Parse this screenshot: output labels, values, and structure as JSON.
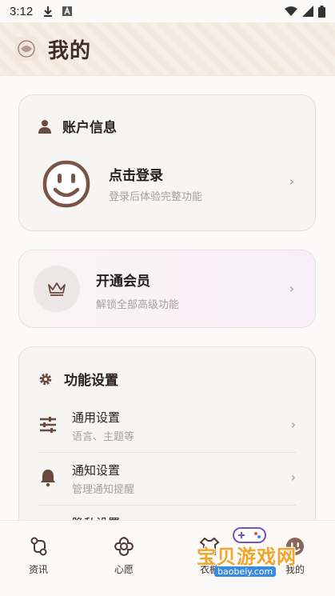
{
  "status_bar": {
    "time": "3:12",
    "icons": [
      "download-icon",
      "a-box-icon",
      "wifi-icon",
      "signal-icon",
      "battery-icon"
    ]
  },
  "header": {
    "title": "我的"
  },
  "account": {
    "section_title": "账户信息",
    "login_title": "点击登录",
    "login_subtitle": "登录后体验完整功能"
  },
  "vip": {
    "title": "开通会员",
    "subtitle": "解锁全部高级功能"
  },
  "settings": {
    "section_title": "功能设置",
    "items": [
      {
        "title": "通用设置",
        "subtitle": "语言、主题等",
        "icon": "sliders-icon"
      },
      {
        "title": "通知设置",
        "subtitle": "管理通知提醒",
        "icon": "bell-icon"
      },
      {
        "title": "隐私设置",
        "subtitle": "",
        "icon": "lock-icon"
      }
    ]
  },
  "bottom_nav": {
    "items": [
      {
        "label": "资讯",
        "icon": "news-icon"
      },
      {
        "label": "心愿",
        "icon": "flower-icon"
      },
      {
        "label": "衣橱",
        "icon": "wardrobe-icon"
      },
      {
        "label": "我的",
        "icon": "profile-icon"
      }
    ]
  },
  "watermark": {
    "text": "宝贝游戏网",
    "url": "baobeiy.com"
  },
  "colors": {
    "accent": "#6b4a3e",
    "background": "#fbfaf9",
    "watermark": "#f2a52a"
  }
}
